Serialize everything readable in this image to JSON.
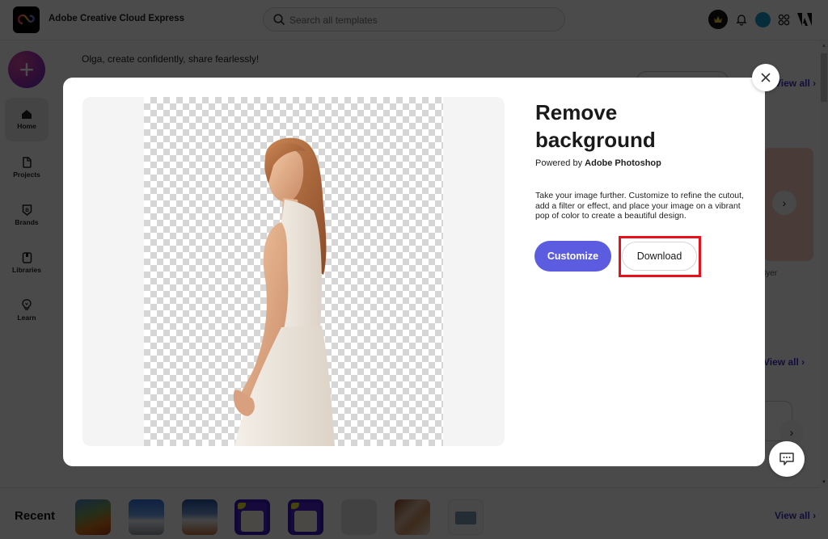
{
  "app": {
    "title": "Adobe Creative Cloud Express",
    "search_placeholder": "Search all templates",
    "greeting": "Olga, create confidently, share fearlessly!",
    "create_label": "+"
  },
  "sidebar": {
    "items": [
      {
        "label": "Home",
        "icon": "home-icon",
        "active": true
      },
      {
        "label": "Projects",
        "icon": "projects-icon",
        "active": false
      },
      {
        "label": "Brands",
        "icon": "brands-icon",
        "active": false
      },
      {
        "label": "Libraries",
        "icon": "libraries-icon",
        "active": false
      },
      {
        "label": "Learn",
        "icon": "learn-icon",
        "active": false
      }
    ]
  },
  "topbar_icons": [
    "premium-crown-icon",
    "bell-icon",
    "user-avatar",
    "apps-grid-icon",
    "adobe-logo-icon"
  ],
  "background": {
    "view_all_1": "View all",
    "view_all_2": "View all",
    "partial_caption": "lyer",
    "recent": {
      "title": "Recent",
      "view_all": "View all",
      "thumbnails": [
        "autumn-forest",
        "mountain-peak-blue",
        "mountain-peak-sunset",
        "your-brand-voice-1",
        "your-brand-voice-2",
        "blank-texture",
        "moodboard-beige",
        "collage-travel"
      ]
    }
  },
  "modal": {
    "title": "Remove background",
    "powered_prefix": "Powered by",
    "powered_brand": "Adobe Photoshop",
    "description": "Take your image further. Customize to refine the cutout, add a filter or effect, and place your image on a vibrant pop of color to create a beautiful design.",
    "customize_label": "Customize",
    "download_label": "Download",
    "accent_color": "#5c5ce0",
    "highlight_color": "#e8101a"
  }
}
